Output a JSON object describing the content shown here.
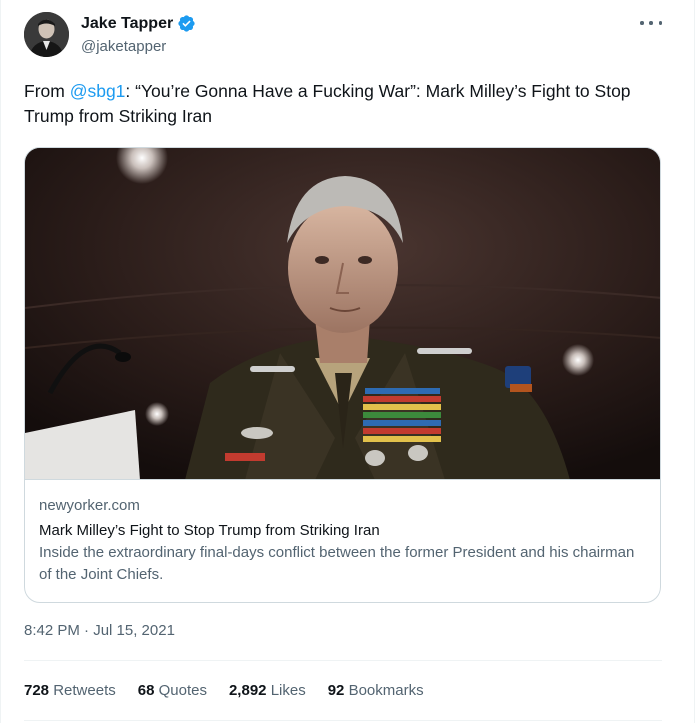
{
  "author": {
    "name": "Jake Tapper",
    "handle": "@jaketapper",
    "verified_color": "#1d9bf0"
  },
  "tweet": {
    "text_prefix": "From ",
    "mention": "@sbg1",
    "text_suffix": ": “You’re Gonna Have a Fucking War”: Mark Milley’s Fight to Stop Trump from Striking Iran"
  },
  "card": {
    "domain": "newyorker.com",
    "title": "Mark Milley’s Fight to Stop Trump from Striking Iran",
    "description": "Inside the extraordinary final-days conflict between the former President and his chairman of the Joint Chiefs."
  },
  "timestamp": "8:42 PM · Jul 15, 2021",
  "stats": [
    {
      "count": "728",
      "label": "Retweets"
    },
    {
      "count": "68",
      "label": "Quotes"
    },
    {
      "count": "2,892",
      "label": "Likes"
    },
    {
      "count": "92",
      "label": "Bookmarks"
    }
  ],
  "colors": {
    "link": "#1d9bf0",
    "secondary_text": "#536471",
    "border": "#cfd9de"
  }
}
